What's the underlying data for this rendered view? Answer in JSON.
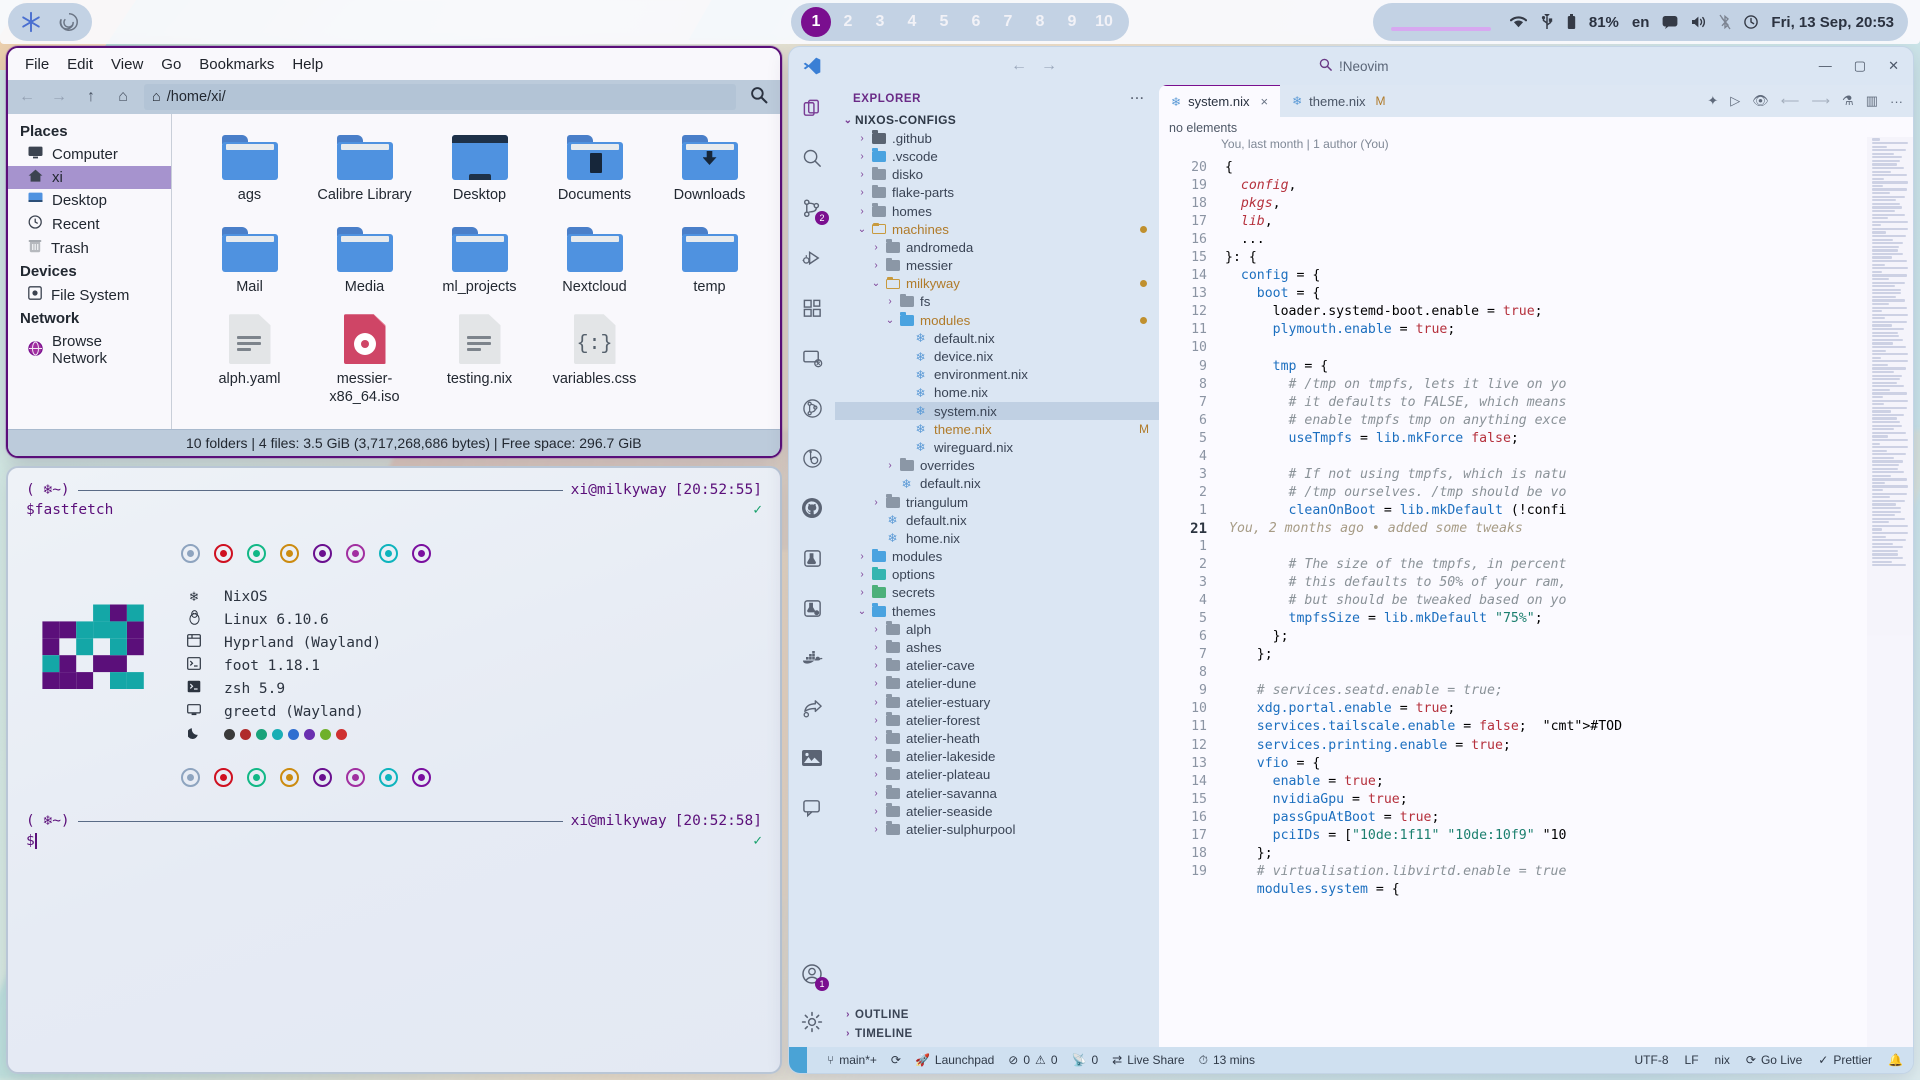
{
  "topbar": {
    "left_icons": [
      "nix-snowflake-icon",
      "spiral-icon"
    ],
    "workspaces": [
      "1",
      "2",
      "3",
      "4",
      "5",
      "6",
      "7",
      "8",
      "9",
      "10"
    ],
    "active_workspace": "1",
    "tray": {
      "wifi_icon": "wifi-icon",
      "usb_icon": "usb-icon",
      "battery_icon": "battery-icon",
      "battery": "81%",
      "keyboard_layout": "en",
      "notification_icon": "notification-icon",
      "volume_icon": "volume-icon",
      "bluetooth_icon": "bluetooth-off-icon",
      "clock_icon": "clock-icon",
      "clock": "Fri, 13 Sep, 20:53"
    }
  },
  "filemanager": {
    "menu": [
      "File",
      "Edit",
      "View",
      "Go",
      "Bookmarks",
      "Help"
    ],
    "path": "/home/xi/",
    "nav": {
      "back": "←",
      "forward": "→",
      "up": "↑",
      "home": "⌂"
    },
    "search_icon": "search-icon",
    "sidebar": [
      {
        "type": "header",
        "label": "Places"
      },
      {
        "type": "item",
        "label": "Computer",
        "icon": "monitor-icon",
        "selected": false
      },
      {
        "type": "item",
        "label": "xi",
        "icon": "home-icon",
        "selected": true
      },
      {
        "type": "item",
        "label": "Desktop",
        "icon": "desktop-icon",
        "selected": false
      },
      {
        "type": "item",
        "label": "Recent",
        "icon": "clock-icon",
        "selected": false
      },
      {
        "type": "item",
        "label": "Trash",
        "icon": "trash-icon",
        "selected": false
      },
      {
        "type": "header",
        "label": "Devices"
      },
      {
        "type": "item",
        "label": "File System",
        "icon": "disk-icon",
        "selected": false
      },
      {
        "type": "header",
        "label": "Network"
      },
      {
        "type": "item",
        "label": "Browse Network",
        "icon": "globe-icon",
        "selected": false
      }
    ],
    "files": [
      {
        "name": "ags",
        "kind": "folder"
      },
      {
        "name": "Calibre Library",
        "kind": "folder"
      },
      {
        "name": "Desktop",
        "kind": "folder-desktop"
      },
      {
        "name": "Documents",
        "kind": "folder-documents"
      },
      {
        "name": "Downloads",
        "kind": "folder-downloads"
      },
      {
        "name": "Mail",
        "kind": "folder"
      },
      {
        "name": "Media",
        "kind": "folder"
      },
      {
        "name": "ml_projects",
        "kind": "folder"
      },
      {
        "name": "Nextcloud",
        "kind": "folder"
      },
      {
        "name": "temp",
        "kind": "folder"
      },
      {
        "name": "alph.yaml",
        "kind": "file-text"
      },
      {
        "name": "messier-x86_64.iso",
        "kind": "file-iso"
      },
      {
        "name": "testing.nix",
        "kind": "file-text"
      },
      {
        "name": "variables.css",
        "kind": "file-code"
      }
    ],
    "status": "10 folders  |  4 files: 3.5 GiB (3,717,268,686 bytes)  |  Free space: 296.7 GiB"
  },
  "terminal": {
    "prompt1": {
      "paren": "( ❄~)",
      "user": "xi@milkyway",
      "time": "[20:52:55]"
    },
    "command": "$fastfetch",
    "prompt2": {
      "paren": "( ❄~)",
      "user": "xi@milkyway",
      "time": "[20:52:58]"
    },
    "command2": "$",
    "dot_colors_top": [
      "#8ea4bf",
      "#cf1020",
      "#12b886",
      "#cc8b10",
      "#6a0f8f",
      "#a12fa0",
      "#0eb4bd",
      "#7a0f9f"
    ],
    "dot_colors_bottom": [
      "#8ea4bf",
      "#cf1020",
      "#12b886",
      "#cc8b10",
      "#6a0f8f",
      "#a12fa0",
      "#0eb4bd",
      "#7a0f9f"
    ],
    "fastfetch": [
      {
        "icon": "nix-icon",
        "value": "NixOS"
      },
      {
        "icon": "linux-icon",
        "value": "Linux 6.10.6"
      },
      {
        "icon": "window-icon",
        "value": "Hyprland (Wayland)"
      },
      {
        "icon": "terminal-icon",
        "value": "foot 1.18.1"
      },
      {
        "icon": "shell-icon",
        "value": "zsh 5.9"
      },
      {
        "icon": "display-icon",
        "value": "greetd (Wayland)"
      },
      {
        "icon": "moon-icon",
        "value": ""
      }
    ],
    "palette": [
      "#3a3a3a",
      "#b02a2a",
      "#1aa37a",
      "#1aaeb5",
      "#2f6fd0",
      "#6a2fb0",
      "#6fb02a",
      "#cf3030"
    ],
    "logo_colors": [
      "#5b0f7a",
      "#14a7a7"
    ]
  },
  "vscode": {
    "search_placeholder": "!Neovim",
    "search_icon": "search-icon",
    "nav_back": "←",
    "nav_forward": "→",
    "window_buttons": [
      "minimize-icon",
      "maximize-icon",
      "close-icon"
    ],
    "activity_bar": [
      {
        "name": "explorer-icon",
        "badge": null
      },
      {
        "name": "search-icon",
        "badge": null
      },
      {
        "name": "source-control-icon",
        "badge": "2"
      },
      {
        "name": "run-debug-icon",
        "badge": null
      },
      {
        "name": "extensions-icon",
        "badge": null
      },
      {
        "name": "remote-explorer-icon",
        "badge": null
      },
      {
        "name": "git-graph-icon",
        "badge": null
      },
      {
        "name": "git-lens-icon",
        "badge": null
      },
      {
        "name": "github-icon",
        "badge": null
      },
      {
        "name": "testing-icon",
        "badge": null
      },
      {
        "name": "test-explorer-icon",
        "badge": null
      },
      {
        "name": "docker-icon",
        "badge": null
      },
      {
        "name": "share-icon",
        "badge": null
      },
      {
        "name": "image-preview-icon",
        "badge": null
      },
      {
        "name": "chat-icon",
        "badge": null
      }
    ],
    "activity_bar_bottom": [
      {
        "name": "accounts-icon",
        "badge": "1"
      },
      {
        "name": "settings-gear-icon",
        "badge": null
      }
    ],
    "explorer": {
      "title": "EXPLORER",
      "more_icon": "ellipsis-icon",
      "root": "NIXOS-CONFIGS",
      "tree": [
        {
          "label": ".github",
          "depth": 1,
          "type": "folder",
          "icon": "folder-github",
          "state": "collapsed"
        },
        {
          "label": ".vscode",
          "depth": 1,
          "type": "folder",
          "icon": "folder-vscode",
          "state": "collapsed"
        },
        {
          "label": "disko",
          "depth": 1,
          "type": "folder",
          "icon": "folder-grey",
          "state": "collapsed"
        },
        {
          "label": "flake-parts",
          "depth": 1,
          "type": "folder",
          "icon": "folder-grey",
          "state": "collapsed"
        },
        {
          "label": "homes",
          "depth": 1,
          "type": "folder",
          "icon": "folder-grey",
          "state": "collapsed"
        },
        {
          "label": "machines",
          "depth": 1,
          "type": "folder",
          "icon": "folder-open",
          "state": "expanded",
          "gold": true,
          "dirty": true
        },
        {
          "label": "andromeda",
          "depth": 2,
          "type": "folder",
          "icon": "folder-grey",
          "state": "collapsed"
        },
        {
          "label": "messier",
          "depth": 2,
          "type": "folder",
          "icon": "folder-grey",
          "state": "collapsed"
        },
        {
          "label": "milkyway",
          "depth": 2,
          "type": "folder",
          "icon": "folder-open",
          "state": "expanded",
          "gold": true,
          "dirty": true
        },
        {
          "label": "fs",
          "depth": 3,
          "type": "folder",
          "icon": "folder-grey",
          "state": "collapsed"
        },
        {
          "label": "modules",
          "depth": 3,
          "type": "folder",
          "icon": "folder-blue",
          "state": "expanded",
          "gold": true,
          "dirty": true
        },
        {
          "label": "default.nix",
          "depth": 4,
          "type": "file",
          "icon": "nix-file"
        },
        {
          "label": "device.nix",
          "depth": 4,
          "type": "file",
          "icon": "nix-file"
        },
        {
          "label": "environment.nix",
          "depth": 4,
          "type": "file",
          "icon": "nix-file"
        },
        {
          "label": "home.nix",
          "depth": 4,
          "type": "file",
          "icon": "nix-file"
        },
        {
          "label": "system.nix",
          "depth": 4,
          "type": "file",
          "icon": "nix-file",
          "selected": true
        },
        {
          "label": "theme.nix",
          "depth": 4,
          "type": "file",
          "icon": "nix-file",
          "gold": true,
          "badge": "M"
        },
        {
          "label": "wireguard.nix",
          "depth": 4,
          "type": "file",
          "icon": "nix-file"
        },
        {
          "label": "overrides",
          "depth": 3,
          "type": "folder",
          "icon": "folder-grey",
          "state": "collapsed"
        },
        {
          "label": "default.nix",
          "depth": 3,
          "type": "file",
          "icon": "nix-file"
        },
        {
          "label": "triangulum",
          "depth": 2,
          "type": "folder",
          "icon": "folder-grey",
          "state": "collapsed"
        },
        {
          "label": "default.nix",
          "depth": 2,
          "type": "file",
          "icon": "nix-file"
        },
        {
          "label": "home.nix",
          "depth": 2,
          "type": "file",
          "icon": "nix-file"
        },
        {
          "label": "modules",
          "depth": 1,
          "type": "folder",
          "icon": "folder-blue",
          "state": "collapsed"
        },
        {
          "label": "options",
          "depth": 1,
          "type": "folder",
          "icon": "folder-teal",
          "state": "collapsed"
        },
        {
          "label": "secrets",
          "depth": 1,
          "type": "folder",
          "icon": "folder-green",
          "state": "collapsed"
        },
        {
          "label": "themes",
          "depth": 1,
          "type": "folder",
          "icon": "folder-blue",
          "state": "expanded"
        },
        {
          "label": "alph",
          "depth": 2,
          "type": "folder",
          "icon": "folder-grey",
          "state": "collapsed"
        },
        {
          "label": "ashes",
          "depth": 2,
          "type": "folder",
          "icon": "folder-grey",
          "state": "collapsed"
        },
        {
          "label": "atelier-cave",
          "depth": 2,
          "type": "folder",
          "icon": "folder-grey",
          "state": "collapsed"
        },
        {
          "label": "atelier-dune",
          "depth": 2,
          "type": "folder",
          "icon": "folder-grey",
          "state": "collapsed"
        },
        {
          "label": "atelier-estuary",
          "depth": 2,
          "type": "folder",
          "icon": "folder-grey",
          "state": "collapsed"
        },
        {
          "label": "atelier-forest",
          "depth": 2,
          "type": "folder",
          "icon": "folder-grey",
          "state": "collapsed"
        },
        {
          "label": "atelier-heath",
          "depth": 2,
          "type": "folder",
          "icon": "folder-grey",
          "state": "collapsed"
        },
        {
          "label": "atelier-lakeside",
          "depth": 2,
          "type": "folder",
          "icon": "folder-grey",
          "state": "collapsed"
        },
        {
          "label": "atelier-plateau",
          "depth": 2,
          "type": "folder",
          "icon": "folder-grey",
          "state": "collapsed"
        },
        {
          "label": "atelier-savanna",
          "depth": 2,
          "type": "folder",
          "icon": "folder-grey",
          "state": "collapsed"
        },
        {
          "label": "atelier-seaside",
          "depth": 2,
          "type": "folder",
          "icon": "folder-grey",
          "state": "collapsed"
        },
        {
          "label": "atelier-sulphurpool",
          "depth": 2,
          "type": "folder",
          "icon": "folder-grey",
          "state": "collapsed"
        }
      ],
      "outline": "OUTLINE",
      "timeline": "TIMELINE"
    },
    "tabs": [
      {
        "label": "system.nix",
        "icon": "nix-file",
        "active": true,
        "close": "×",
        "modified": ""
      },
      {
        "label": "theme.nix",
        "icon": "nix-file",
        "active": false,
        "close": "",
        "modified": "M"
      }
    ],
    "tab_actions": [
      "sparkle-icon",
      "run-icon",
      "split-preview-icon",
      "back-icon",
      "forward-icon",
      "beaker-icon",
      "split-editor-icon",
      "ellipsis-icon"
    ],
    "no_elements": "no elements",
    "blame": "You, last month | 1 author (You)",
    "inline_blame": "You, 2 months ago • added some tweaks",
    "gutter": [
      "20",
      "19",
      "18",
      "17",
      "16",
      "15",
      "14",
      "13",
      "12",
      "11",
      "10",
      "9",
      "8",
      "7",
      "6",
      "5",
      "4",
      "3",
      "2",
      "1",
      "21",
      "1",
      "2",
      "3",
      "4",
      "5",
      "6",
      "7",
      "8",
      "9",
      "10",
      "11",
      "12",
      "13",
      "14",
      "15",
      "16",
      "17",
      "18",
      "19"
    ],
    "current_line": "21",
    "code": [
      "{",
      "  config,",
      "  pkgs,",
      "  lib,",
      "  ...",
      "}: {",
      "  config = {",
      "    boot = {",
      "      loader.systemd-boot.enable = true;",
      "      plymouth.enable = true;",
      "",
      "      tmp = {",
      "        # /tmp on tmpfs, lets it live on yo",
      "        # it defaults to FALSE, which means",
      "        # enable tmpfs tmp on anything exce",
      "        useTmpfs = lib.mkForce false;",
      "",
      "        # If not using tmpfs, which is natu",
      "        # /tmp ourselves. /tmp should be vo",
      "        cleanOnBoot = lib.mkDefault (!confi",
      "",
      "        # The size of the tmpfs, in percent",
      "        # this defaults to 50% of your ram,",
      "        # but should be tweaked based on yo",
      "        tmpfsSize = lib.mkDefault \"75%\";",
      "      };",
      "    };",
      "",
      "    # services.seatd.enable = true;",
      "    xdg.portal.enable = true;",
      "    services.tailscale.enable = false;  #TOD",
      "    services.printing.enable = true;",
      "    vfio = {",
      "      enable = true;",
      "      nvidiaGpu = true;",
      "      passGpuAtBoot = true;",
      "      pciIDs = [\"10de:1f11\" \"10de:10f9\" \"10",
      "    };",
      "    # virtualisation.libvirtd.enable = true",
      "    modules.system = {"
    ],
    "statusbar": {
      "remote_icon": "remote-icon",
      "branch_icon": "git-branch-icon",
      "branch": "main*+",
      "sync_icon": "sync-icon",
      "rocket_icon": "rocket-icon",
      "launchpad": "Launchpad",
      "errors_icon": "error-icon",
      "errors": "0",
      "warnings_icon": "warning-icon",
      "warnings": "0",
      "radio_icon": "radio-tower-icon",
      "ports": "0",
      "live_share": "Live Share",
      "timer_icon": "watch-icon",
      "timer": "13 mins",
      "encoding": "UTF-8",
      "eol": "LF",
      "language": "nix",
      "go_live": "Go Live",
      "prettier": "Prettier",
      "bell_icon": "bell-icon",
      "check_icon": "check-icon"
    }
  }
}
